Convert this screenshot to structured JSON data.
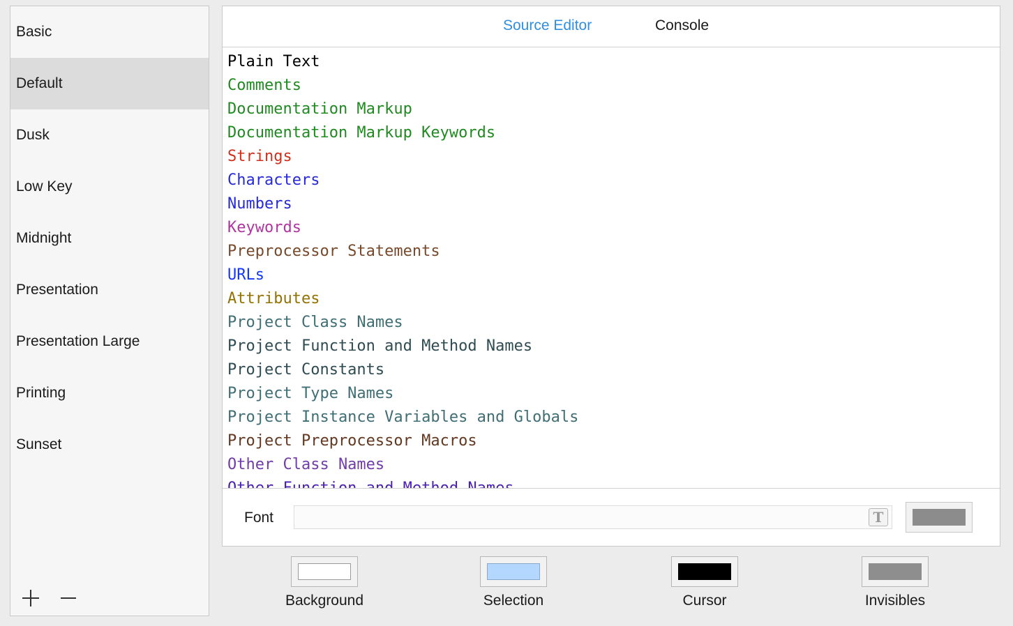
{
  "themes": {
    "items": [
      "Basic",
      "Default",
      "Dusk",
      "Low Key",
      "Midnight",
      "Presentation",
      "Presentation Large",
      "Printing",
      "Sunset"
    ],
    "selected": "Default",
    "add_icon": "plus-icon",
    "remove_icon": "minus-icon"
  },
  "tabs": [
    {
      "label": "Source Editor",
      "active": true
    },
    {
      "label": "Console",
      "active": false
    }
  ],
  "syntax_items": [
    {
      "label": "Plain Text",
      "color": "#000000"
    },
    {
      "label": "Comments",
      "color": "#1f8a1f"
    },
    {
      "label": "Documentation Markup",
      "color": "#1f8a1f"
    },
    {
      "label": "Documentation Markup Keywords",
      "color": "#1f8a1f"
    },
    {
      "label": "Strings",
      "color": "#d12f1b"
    },
    {
      "label": "Characters",
      "color": "#272ad8"
    },
    {
      "label": "Numbers",
      "color": "#272ad8"
    },
    {
      "label": "Keywords",
      "color": "#b234a1"
    },
    {
      "label": "Preprocessor Statements",
      "color": "#78492a"
    },
    {
      "label": "URLs",
      "color": "#1337ff"
    },
    {
      "label": "Attributes",
      "color": "#947100"
    },
    {
      "label": "Project Class Names",
      "color": "#3f6e74"
    },
    {
      "label": "Project Function and Method Names",
      "color": "#2e4c51"
    },
    {
      "label": "Project Constants",
      "color": "#2e4c51"
    },
    {
      "label": "Project Type Names",
      "color": "#3f6e74"
    },
    {
      "label": "Project Instance Variables and Globals",
      "color": "#3f6e74"
    },
    {
      "label": "Project Preprocessor Macros",
      "color": "#643820"
    },
    {
      "label": "Other Class Names",
      "color": "#703daa"
    },
    {
      "label": "Other Function and Method Names",
      "color": "#4b21b0"
    }
  ],
  "font": {
    "label": "Font",
    "value": "",
    "picker_icon": "font-picker-icon",
    "picker_glyph": "T",
    "color": "#8c8c8c"
  },
  "wells": [
    {
      "label": "Background",
      "color": "#ffffff"
    },
    {
      "label": "Selection",
      "color": "#b3d7ff"
    },
    {
      "label": "Cursor",
      "color": "#000000"
    },
    {
      "label": "Invisibles",
      "color": "#8e8e8e"
    }
  ]
}
